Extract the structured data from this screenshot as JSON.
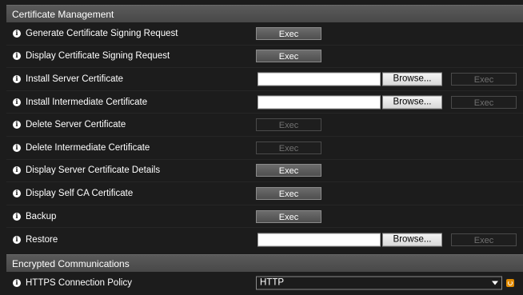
{
  "sections": {
    "cert_management": "Certificate Management",
    "encrypted": "Encrypted Communications"
  },
  "exec_label": "Exec",
  "browse_label": "Browse...",
  "rows": {
    "generate_csr": "Generate Certificate Signing Request",
    "display_csr": "Display Certificate Signing Request",
    "install_server": "Install Server Certificate",
    "install_intermediate": "Install Intermediate Certificate",
    "delete_server": "Delete Server Certificate",
    "delete_intermediate": "Delete Intermediate Certificate",
    "display_server_details": "Display Server Certificate Details",
    "display_self_ca": "Display Self CA Certificate",
    "backup": "Backup",
    "restore": "Restore",
    "https_policy": "HTTPS Connection Policy"
  },
  "https_policy_value": "HTTP",
  "icons": {
    "info": "info-icon",
    "dropdown": "chevron-down-icon",
    "power": "power-icon"
  },
  "colors": {
    "header_bg": "#4d4d4d",
    "page_bg": "#1c1c1c",
    "accent": "#e08a00"
  }
}
